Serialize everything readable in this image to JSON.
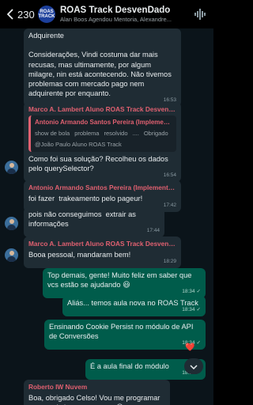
{
  "header": {
    "unread_count": "230",
    "group_avatar_text": "ROAS TRACK",
    "title": "ROAS Track DesvenDado",
    "subtitle": "Alan Boos Agendou Mentoria, Alexandre..."
  },
  "messages": [
    {
      "text": "Adquirente\n\nConsiderações, Vindi costuma dar mais recusas, mas ultimamente, por algum milagre, nin está acontecendo. Não tivemos problemas com mercado pago nem adquirente por enquanto.",
      "time": "16:53"
    },
    {
      "sender": "Marco A. Lambert Aluno ROAS Track DesvenDado",
      "quote_name": "Antonio Armando Santos Pereira (Implementação)",
      "quote_words": [
        "show de bola",
        "problema",
        "resolvido",
        "....",
        "Obrigado"
      ],
      "quote_line2": "@João Paulo Aluno ROAS Track",
      "text": "Como foi sua solução? Recolheu os dados pelo querySelector?",
      "time": "16:54"
    },
    {
      "sender": "Antonio Armando Santos Pereira (Implementação)",
      "text": "foi fazer  trakeamento pelo pageur!",
      "time": "17:42"
    },
    {
      "text": "pois não conseguimos  extrair as informações",
      "time": "17:44"
    },
    {
      "sender": "Marco A. Lambert Aluno ROAS Track DesvenDado",
      "text": "Booa pessoal, mandaram bem!",
      "time": "18:29"
    },
    {
      "text": "Top demais, gente! Muito feliz em saber que vcs estão se ajudando 😃",
      "time": "18:34"
    },
    {
      "text": "Aliás... temos aula nova no ROAS Track",
      "time": "18:34"
    },
    {
      "text": "Ensinando Cookie Persist no módulo de API de Conversões",
      "time": "18:34",
      "reaction": "❤️"
    },
    {
      "text": "É a aula final do módulo",
      "time": "18:34"
    },
    {
      "sender": "Roberto IW Nuvem",
      "text": "Boa, obrigado Celso! Vou me programar para assistir essa semana 😊",
      "time": ""
    }
  ],
  "read_check": "✓",
  "icons": {
    "back": "chevron-left-icon",
    "audio": "audio-wave-icon",
    "scroll": "chevron-down-icon"
  }
}
